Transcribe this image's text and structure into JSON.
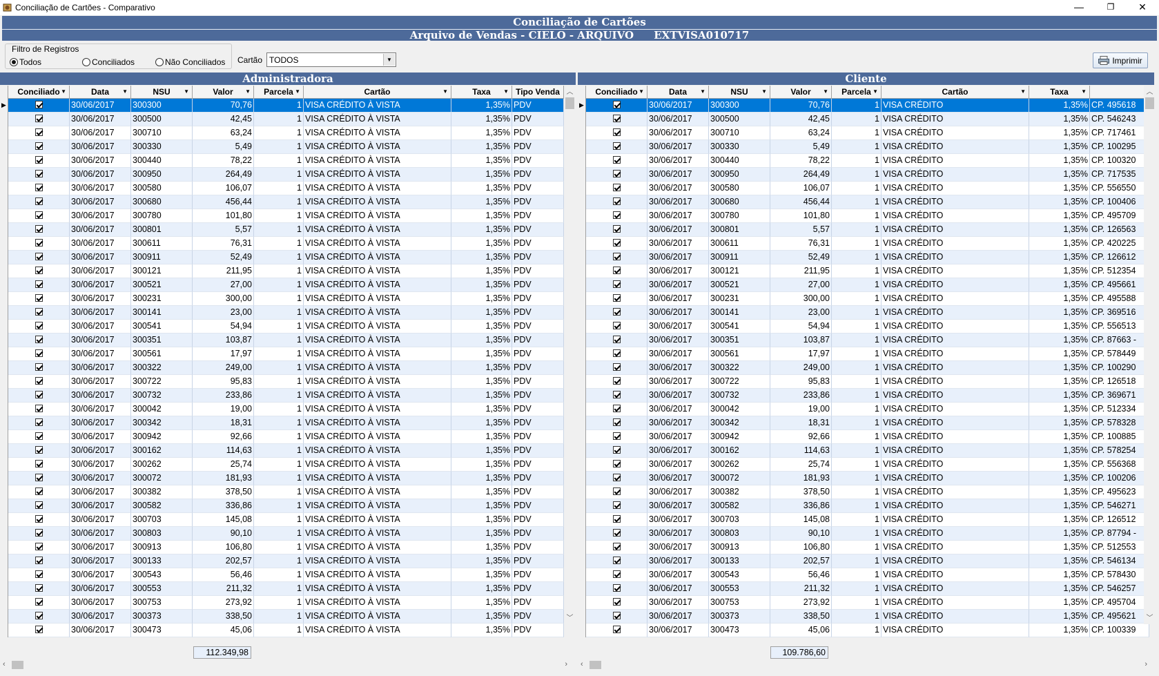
{
  "window": {
    "title": "Conciliação de Cartões - Comparativo",
    "minimize": "—",
    "restore": "❐",
    "close": "✕"
  },
  "banner": {
    "line1": "Conciliação de Cartões",
    "line2a": "Arquivo de Vendas - CIELO - ARQUIVO",
    "line2b": "EXTVISA010717"
  },
  "filter": {
    "legend": "Filtro de Registros",
    "options": [
      "Todos",
      "Conciliados",
      "Não Conciliados"
    ],
    "selected": "Todos",
    "cartao_label": "Cartão",
    "cartao_value": "TODOS"
  },
  "print_label": "Imprimir",
  "admin": {
    "title": "Administradora",
    "headers": [
      "Conciliado",
      "Data",
      "NSU",
      "Valor",
      "Parcela",
      "Cartão",
      "Taxa",
      "Tipo Venda"
    ],
    "card": "VISA CRÉDITO À VISTA",
    "tipo": "PDV",
    "total": "112.349,98"
  },
  "client": {
    "title": "Cliente",
    "headers": [
      "Conciliado",
      "Data",
      "NSU",
      "Valor",
      "Parcela",
      "Cartão",
      "Taxa"
    ],
    "card": "VISA CRÉDITO",
    "total": "109.786,60"
  },
  "common": {
    "date": "30/06/2017",
    "parcela": "1",
    "taxa": "1,35%"
  },
  "rows": [
    {
      "nsu": "300300",
      "valor": "70,76",
      "cp": "CP. 495618"
    },
    {
      "nsu": "300500",
      "valor": "42,45",
      "cp": "CP. 546243"
    },
    {
      "nsu": "300710",
      "valor": "63,24",
      "cp": "CP. 717461"
    },
    {
      "nsu": "300330",
      "valor": "5,49",
      "cp": "CP. 100295"
    },
    {
      "nsu": "300440",
      "valor": "78,22",
      "cp": "CP. 100320"
    },
    {
      "nsu": "300950",
      "valor": "264,49",
      "cp": "CP. 717535"
    },
    {
      "nsu": "300580",
      "valor": "106,07",
      "cp": "CP. 556550"
    },
    {
      "nsu": "300680",
      "valor": "456,44",
      "cp": "CP. 100406"
    },
    {
      "nsu": "300780",
      "valor": "101,80",
      "cp": "CP. 495709"
    },
    {
      "nsu": "300801",
      "valor": "5,57",
      "cp": "CP. 126563"
    },
    {
      "nsu": "300611",
      "valor": "76,31",
      "cp": "CP. 420225"
    },
    {
      "nsu": "300911",
      "valor": "52,49",
      "cp": "CP. 126612"
    },
    {
      "nsu": "300121",
      "valor": "211,95",
      "cp": "CP. 512354"
    },
    {
      "nsu": "300521",
      "valor": "27,00",
      "cp": "CP. 495661"
    },
    {
      "nsu": "300231",
      "valor": "300,00",
      "cp": "CP. 495588"
    },
    {
      "nsu": "300141",
      "valor": "23,00",
      "cp": "CP. 369516"
    },
    {
      "nsu": "300541",
      "valor": "54,94",
      "cp": "CP. 556513"
    },
    {
      "nsu": "300351",
      "valor": "103,87",
      "cp": "CP. 87663 -"
    },
    {
      "nsu": "300561",
      "valor": "17,97",
      "cp": "CP. 578449"
    },
    {
      "nsu": "300322",
      "valor": "249,00",
      "cp": "CP. 100290"
    },
    {
      "nsu": "300722",
      "valor": "95,83",
      "cp": "CP. 126518"
    },
    {
      "nsu": "300732",
      "valor": "233,86",
      "cp": "CP. 369671"
    },
    {
      "nsu": "300042",
      "valor": "19,00",
      "cp": "CP. 512334"
    },
    {
      "nsu": "300342",
      "valor": "18,31",
      "cp": "CP. 578328"
    },
    {
      "nsu": "300942",
      "valor": "92,66",
      "cp": "CP. 100885"
    },
    {
      "nsu": "300162",
      "valor": "114,63",
      "cp": "CP. 578254"
    },
    {
      "nsu": "300262",
      "valor": "25,74",
      "cp": "CP. 556368"
    },
    {
      "nsu": "300072",
      "valor": "181,93",
      "cp": "CP. 100206"
    },
    {
      "nsu": "300382",
      "valor": "378,50",
      "cp": "CP. 495623"
    },
    {
      "nsu": "300582",
      "valor": "336,86",
      "cp": "CP. 546271"
    },
    {
      "nsu": "300703",
      "valor": "145,08",
      "cp": "CP. 126512"
    },
    {
      "nsu": "300803",
      "valor": "90,10",
      "cp": "CP. 87794 -"
    },
    {
      "nsu": "300913",
      "valor": "106,80",
      "cp": "CP. 512553"
    },
    {
      "nsu": "300133",
      "valor": "202,57",
      "cp": "CP. 546134"
    },
    {
      "nsu": "300543",
      "valor": "56,46",
      "cp": "CP. 578430"
    },
    {
      "nsu": "300553",
      "valor": "211,32",
      "cp": "CP. 546257"
    },
    {
      "nsu": "300753",
      "valor": "273,92",
      "cp": "CP. 495704"
    },
    {
      "nsu": "300373",
      "valor": "338,50",
      "cp": "CP. 495621"
    },
    {
      "nsu": "300473",
      "valor": "45,06",
      "cp": "CP. 100339"
    }
  ]
}
